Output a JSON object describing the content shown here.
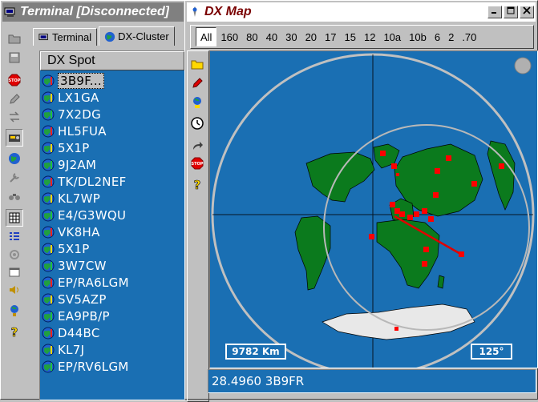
{
  "terminal_window": {
    "title": "Terminal [Disconnected]",
    "tabs": [
      {
        "label": "Terminal",
        "selected": false
      },
      {
        "label": "DX-Cluster",
        "selected": true
      }
    ],
    "list_header": "DX Spot",
    "spots": [
      "3B9F...",
      "LX1GA",
      "7X2DG",
      "HL5FUA",
      "5X1P",
      "9J2AM",
      "TK/DL2NEF",
      "KL7WP",
      "E4/G3WQU",
      "VK8HA",
      "5X1P",
      "3W7CW",
      "EP/RA6LGM",
      "SV5AZP",
      "EA9PB/P",
      "D44BC",
      "KL7J",
      "EP/RV6LGM"
    ],
    "selected_index": 0
  },
  "dxmap_window": {
    "title": "DX Map",
    "caption_buttons": [
      "minimize",
      "maximize",
      "close"
    ],
    "bands": [
      "All",
      "160",
      "80",
      "40",
      "30",
      "20",
      "17",
      "15",
      "12",
      "10a",
      "10b",
      "6",
      "2",
      ".70"
    ],
    "selected_band": "All",
    "distance": "9782 Km",
    "bearing": "125°",
    "status": "28.4960 3B9FR"
  },
  "colors": {
    "ocean": "#1a6fb3",
    "land": "#0b7a1d",
    "antarctica": "#e8e8e8",
    "spot": "#ff0000",
    "desktop": "#c0c0c0"
  }
}
